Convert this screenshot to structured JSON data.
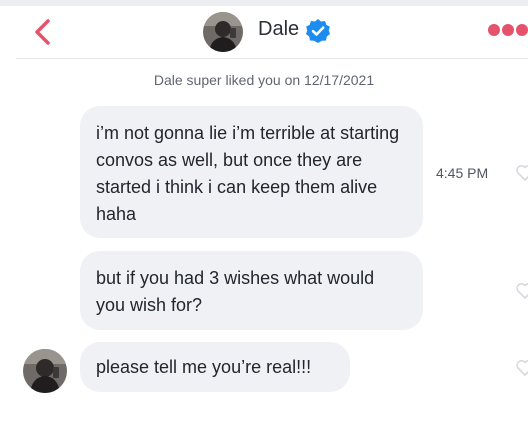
{
  "header": {
    "name": "Dale",
    "back_icon": "chevron-left-icon",
    "verified_icon": "verified-badge-icon",
    "more_icon": "more-options-icon",
    "accent_color": "#e4526c",
    "verified_color": "#1d8cf0"
  },
  "meta": {
    "super_like_text": "Dale super liked you on 12/17/2021"
  },
  "messages": [
    {
      "text": "i’m not gonna lie i’m terrible at starting convos as well, but once they are started i think i can keep them alive haha",
      "time": "4:45 PM"
    },
    {
      "text": "but if you had 3 wishes what would you wish for?"
    },
    {
      "text": "please tell me you’re real!!!"
    }
  ]
}
